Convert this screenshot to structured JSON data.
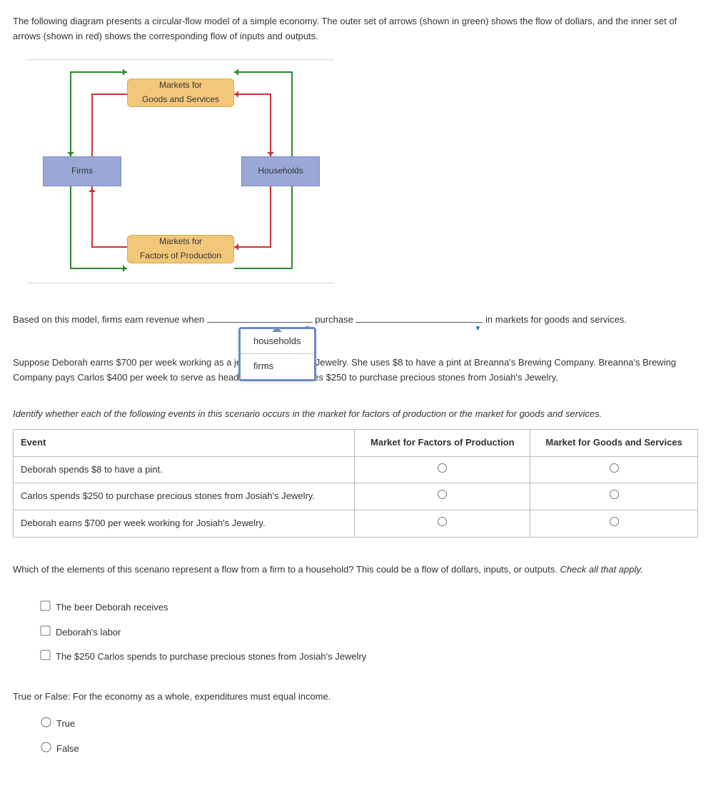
{
  "intro": "The following diagram presents a circular-flow model of a simple economy. The outer set of arrows (shown in green) shows the flow of dollars, and the inner set of arrows (shown in red) shows the corresponding flow of inputs and outputs.",
  "diagram": {
    "market_goods": "Markets for\nGoods and Services",
    "market_factors": "Markets for\nFactors of Production",
    "firms": "Firms",
    "households": "Households"
  },
  "fill1": {
    "pre": "Based on this model, firms earn revenue when ",
    "mid": " purchase ",
    "post": " in markets for goods and services."
  },
  "dropdown": {
    "opt1": "households",
    "opt2": "firms"
  },
  "scenario": "Suppose Deborah earns $700 per week working as a jeweler for Josiah's Jewelry. She uses $8 to have a pint at Breanna's Brewing Company. Breanna's Brewing Company pays Carlos $400 per week to serve as head brewer. Carlos uses $250 to purchase precious stones from Josiah's Jewelry.",
  "table_instruction": "Identify whether each of the following events in this scenario occurs in the market for factors of production or the market for goods and services.",
  "table": {
    "h_event": "Event",
    "h_factors": "Market for Factors of Production",
    "h_goods": "Market for Goods and Services",
    "rows": [
      "Deborah spends $8 to have a pint.",
      "Carlos spends $250 to purchase precious stones from Josiah's Jewelry.",
      "Deborah earns $700 per week working for Josiah's Jewelry."
    ]
  },
  "flow_q": {
    "text": "Which of the elements of this scenario represent a flow from a firm to a household? This could be a flow of dollars, inputs, or outputs. ",
    "caq": "Check all that apply.",
    "opts": [
      "The beer Deborah receives",
      "Deborah's labor",
      "The $250 Carlos spends to purchase precious stones from Josiah's Jewelry"
    ]
  },
  "tf": {
    "q": "True or False: For the economy as a whole, expenditures must equal income.",
    "t": "True",
    "f": "False"
  }
}
